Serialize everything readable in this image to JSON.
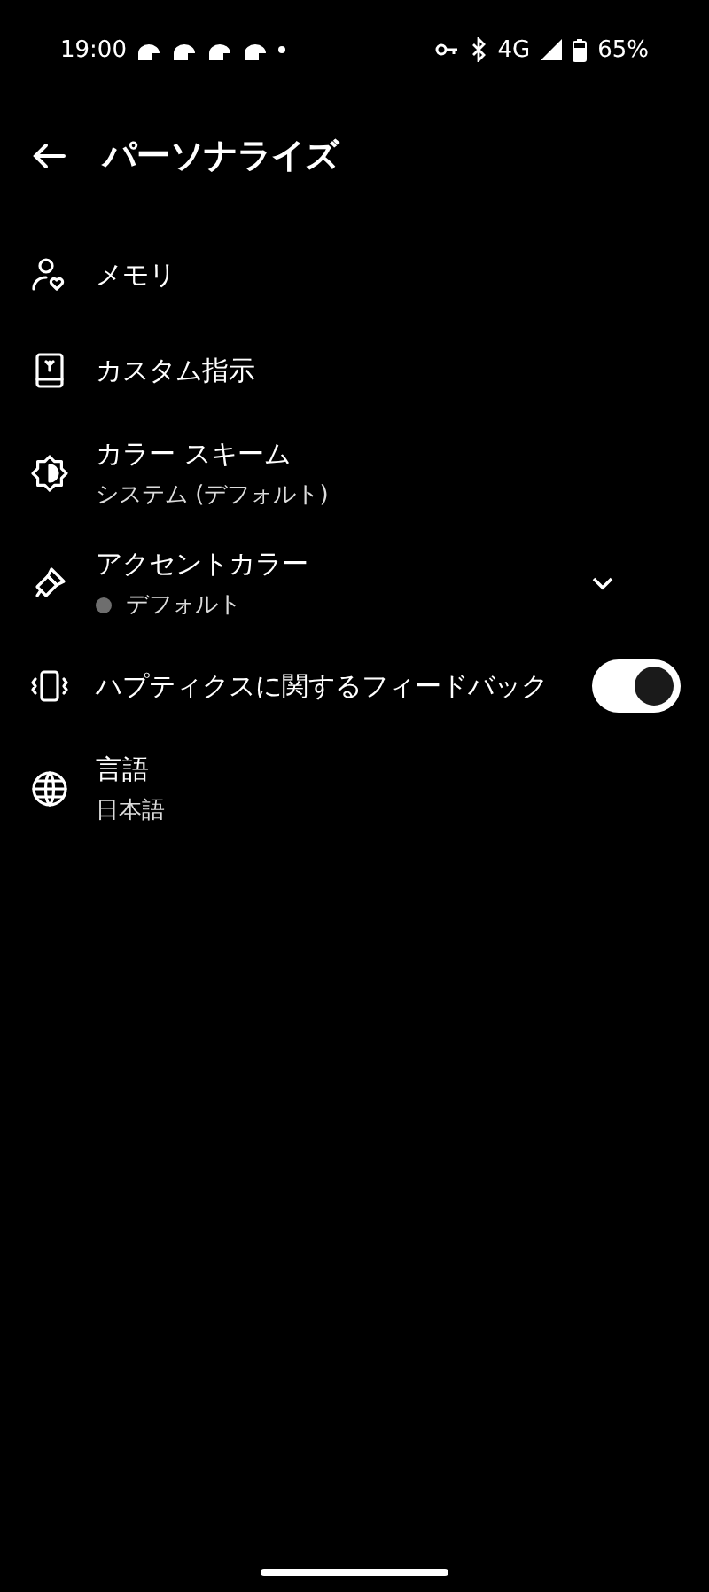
{
  "status_bar": {
    "time": "19:00",
    "network": "4G",
    "battery": "65%"
  },
  "header": {
    "title": "パーソナライズ"
  },
  "items": [
    {
      "kind": "nav",
      "title": "メモリ"
    },
    {
      "kind": "nav",
      "title": "カスタム指示"
    },
    {
      "kind": "nav",
      "title": "カラー スキーム",
      "subtitle": "システム (デフォルト)"
    },
    {
      "kind": "dropdown",
      "title": "アクセントカラー",
      "subtitle": "デフォルト",
      "color": "#6e6e6e"
    },
    {
      "kind": "toggle",
      "title": "ハプティクスに関するフィードバック",
      "on": true
    },
    {
      "kind": "nav",
      "title": "言語",
      "subtitle": "日本語"
    }
  ]
}
